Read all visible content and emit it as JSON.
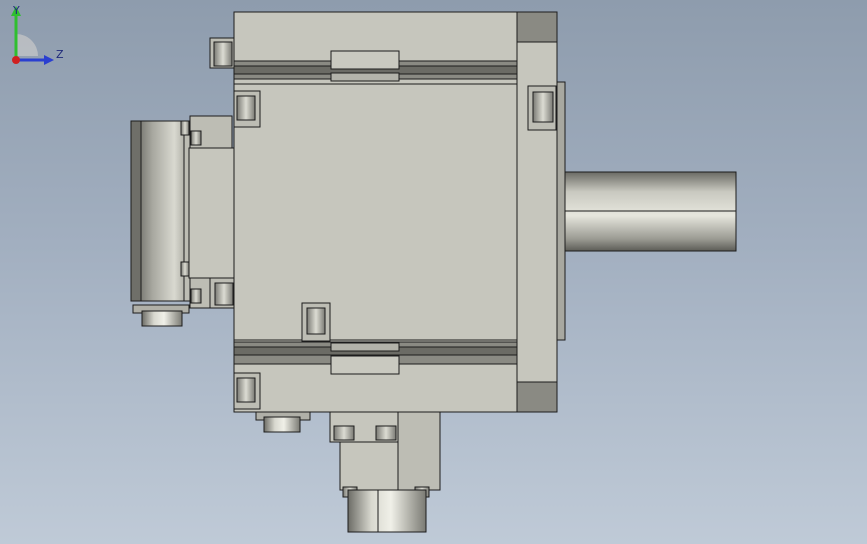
{
  "viewport": {
    "background_top": "#8e9cad",
    "background_bottom": "#bfcad7",
    "body_fill": "#c6c6bd",
    "edge_color": "#1c1c1c",
    "dark_band": "#7b7b74"
  },
  "triad": {
    "x_label": "",
    "y_label": "Y",
    "z_label": "Z",
    "y_color": "#2fbf2f",
    "z_color": "#2a3fd0",
    "x_color": "#d02020"
  }
}
